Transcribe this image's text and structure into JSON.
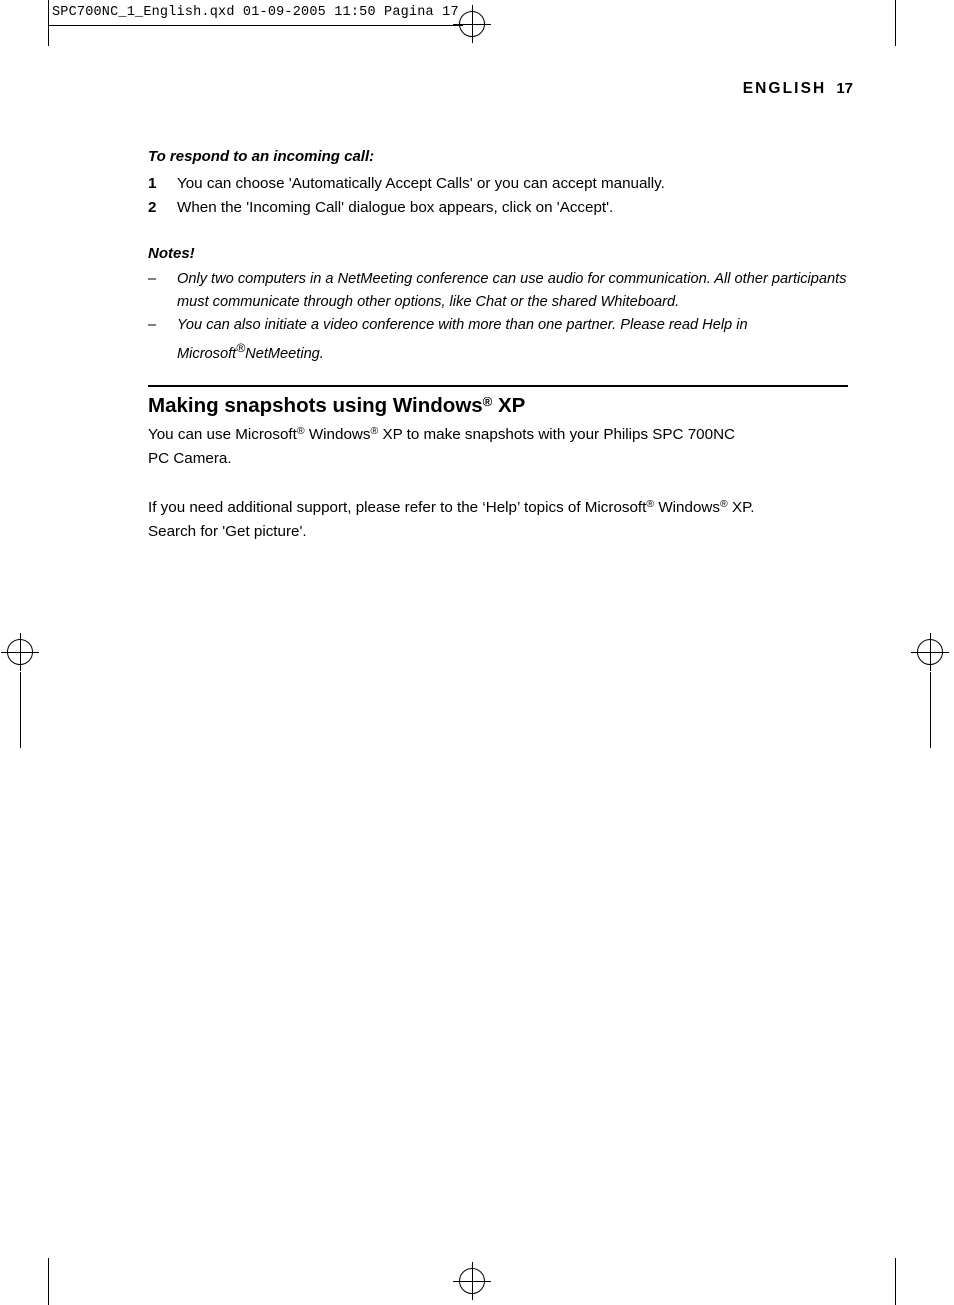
{
  "file_header": {
    "text": "SPC700NC_1_English.qxd  01-09-2005  11:50  Pagina 17"
  },
  "running_head": {
    "language": "ENGLISH",
    "page_number": "17"
  },
  "sections": {
    "respond_heading": "To respond to an incoming call:",
    "steps": [
      {
        "num": "1",
        "text": "You can choose 'Automatically Accept Calls' or you can accept manually."
      },
      {
        "num": "2",
        "text": "When the 'Incoming Call' dialogue box appears, click on 'Accept'."
      }
    ],
    "notes_heading": "Notes!",
    "notes": [
      {
        "dash": "–",
        "text": "Only two computers in a NetMeeting conference can use audio for communication. All other participants must communicate through other options, like Chat or the shared Whiteboard."
      },
      {
        "dash": "–",
        "text_part1": "You can also initiate a video conference with more than one partner. Please read Help in Microsoft",
        "sup": "®",
        "text_part2": "NetMeeting."
      }
    ],
    "snapshots": {
      "title_part1": "Making snapshots using Windows",
      "title_sup": "®",
      "title_part2": " XP",
      "para1_a": "You can use Microsoft",
      "para1_sup1": "®",
      "para1_b": " Windows",
      "para1_sup2": "®",
      "para1_c": " XP to make snapshots with your Philips SPC 700NC",
      "para1_d": "PC Camera.",
      "para2_a": "If you need additional support, please refer to the ‘Help’ topics of Microsoft",
      "para2_sup1": "®",
      "para2_b": " Windows",
      "para2_sup2": "®",
      "para2_c": " XP.",
      "para2_d": "Search for 'Get picture'."
    }
  },
  "colors": {
    "text": "#000000",
    "background": "#ffffff"
  }
}
